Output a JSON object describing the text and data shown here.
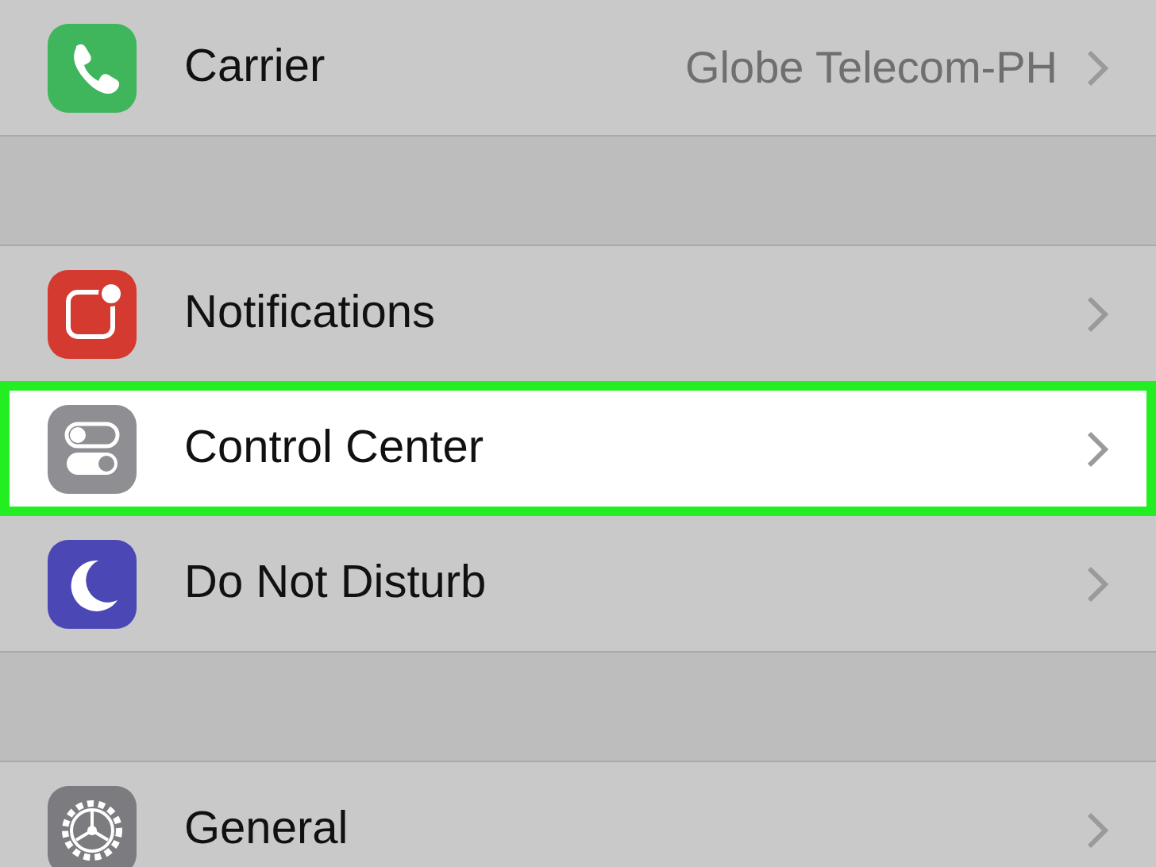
{
  "sections": [
    {
      "rows": [
        {
          "label": "Carrier",
          "value": "Globe Telecom-PH",
          "kind": "phone",
          "color": "#3fb55c",
          "highlighted": false
        }
      ]
    },
    {
      "rows": [
        {
          "label": "Notifications",
          "kind": "notifications",
          "color": "#d43a30",
          "highlighted": false
        },
        {
          "label": "Control Center",
          "kind": "switches",
          "color": "#8e8e93",
          "highlighted": true
        },
        {
          "label": "Do Not Disturb",
          "kind": "moon",
          "color": "#4b48b5",
          "highlighted": false
        }
      ]
    },
    {
      "rows": [
        {
          "label": "General",
          "kind": "gear",
          "color": "#7c7c80",
          "highlighted": false
        }
      ]
    }
  ]
}
